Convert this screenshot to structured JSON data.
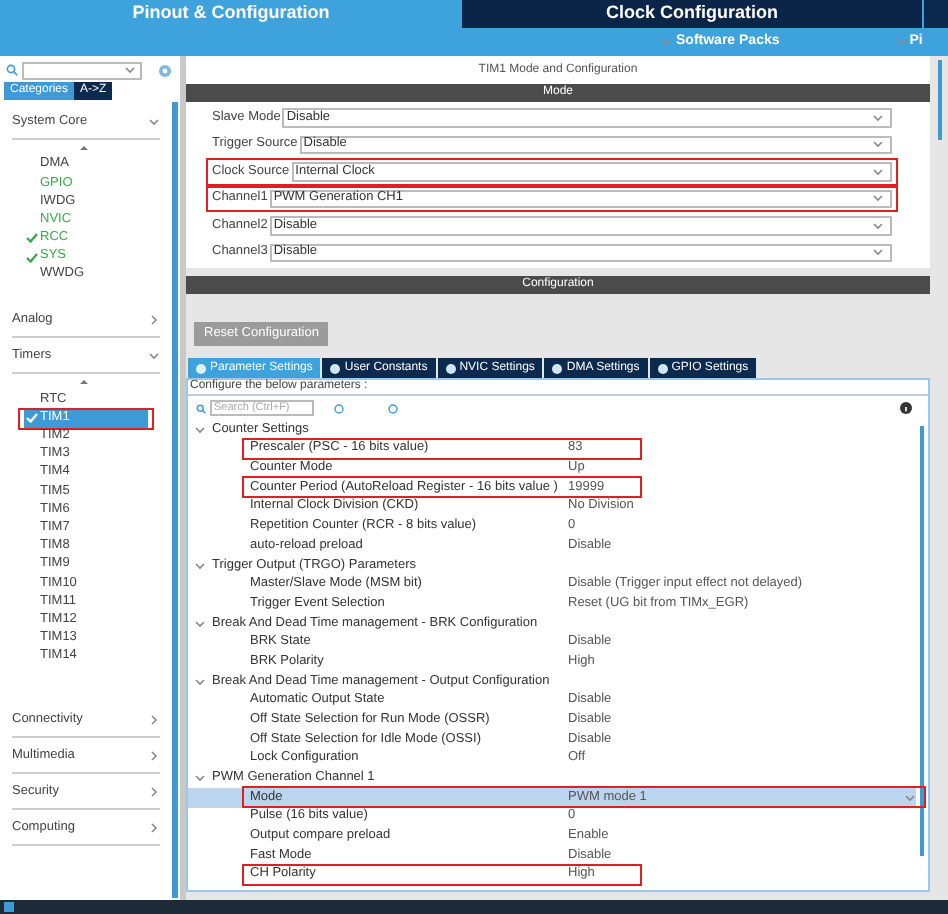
{
  "top_tabs": [
    {
      "label": "Pinout & Configuration",
      "selected": true
    },
    {
      "label": "Clock Configuration",
      "selected": false
    }
  ],
  "sub_bar": {
    "software_packs": "Software Packs",
    "cut_item": "Pi"
  },
  "sidebar": {
    "tabs": [
      {
        "label": "Categories",
        "selected": true
      },
      {
        "label": "A->Z",
        "selected": false
      }
    ],
    "categories": [
      {
        "label": "System Core",
        "expanded": true,
        "items": [
          {
            "label": "DMA",
            "kind": "plain",
            "selected": false,
            "highlighted": false
          },
          {
            "label": "GPIO",
            "kind": "partial",
            "selected": false,
            "highlighted": false
          },
          {
            "label": "IWDG",
            "kind": "plain",
            "selected": false,
            "highlighted": false
          },
          {
            "label": "NVIC",
            "kind": "partial",
            "selected": false,
            "highlighted": false
          },
          {
            "label": "RCC",
            "kind": "ok",
            "selected": false,
            "highlighted": false
          },
          {
            "label": "SYS",
            "kind": "ok",
            "selected": false,
            "highlighted": false
          },
          {
            "label": "WWDG",
            "kind": "plain",
            "selected": false,
            "highlighted": false
          }
        ]
      },
      {
        "label": "Analog",
        "expanded": false
      },
      {
        "label": "Timers",
        "expanded": true,
        "items": [
          {
            "label": "RTC",
            "kind": "plain",
            "selected": false,
            "highlighted": false
          },
          {
            "label": "TIM1",
            "kind": "ok",
            "selected": true,
            "highlighted": true
          },
          {
            "label": "TIM2",
            "kind": "plain",
            "selected": false,
            "highlighted": false
          },
          {
            "label": "TIM3",
            "kind": "plain",
            "selected": false,
            "highlighted": false
          },
          {
            "label": "TIM4",
            "kind": "plain",
            "selected": false,
            "highlighted": false
          },
          {
            "label": "TIM5",
            "kind": "plain",
            "selected": false,
            "highlighted": false
          },
          {
            "label": "TIM6",
            "kind": "plain",
            "selected": false,
            "highlighted": false
          },
          {
            "label": "TIM7",
            "kind": "plain",
            "selected": false,
            "highlighted": false
          },
          {
            "label": "TIM8",
            "kind": "plain",
            "selected": false,
            "highlighted": false
          },
          {
            "label": "TIM9",
            "kind": "plain",
            "selected": false,
            "highlighted": false
          },
          {
            "label": "TIM10",
            "kind": "plain",
            "selected": false,
            "highlighted": false
          },
          {
            "label": "TIM11",
            "kind": "plain",
            "selected": false,
            "highlighted": false
          },
          {
            "label": "TIM12",
            "kind": "plain",
            "selected": false,
            "highlighted": false
          },
          {
            "label": "TIM13",
            "kind": "plain",
            "selected": false,
            "highlighted": false
          },
          {
            "label": "TIM14",
            "kind": "plain",
            "selected": false,
            "highlighted": false
          }
        ]
      },
      {
        "label": "Connectivity",
        "expanded": false
      },
      {
        "label": "Multimedia",
        "expanded": false
      },
      {
        "label": "Security",
        "expanded": false
      },
      {
        "label": "Computing",
        "expanded": false
      }
    ]
  },
  "panel": {
    "title": "TIM1 Mode and Configuration",
    "mode_header": "Mode",
    "mode_rows": [
      {
        "label": "Slave Mode",
        "value": "Disable",
        "highlighted": false
      },
      {
        "label": "Trigger Source",
        "value": "Disable",
        "highlighted": false
      },
      {
        "label": "Clock Source",
        "value": "Internal Clock",
        "highlighted": true
      },
      {
        "label": "Channel1",
        "value": "PWM Generation CH1",
        "highlighted": true
      },
      {
        "label": "Channel2",
        "value": "Disable",
        "highlighted": false
      },
      {
        "label": "Channel3",
        "value": "Disable",
        "highlighted": false
      }
    ],
    "config_header": "Configuration",
    "reset_button": "Reset Configuration",
    "tabs": [
      {
        "label": "Parameter Settings",
        "selected": true
      },
      {
        "label": "User Constants",
        "selected": false
      },
      {
        "label": "NVIC Settings",
        "selected": false
      },
      {
        "label": "DMA Settings",
        "selected": false
      },
      {
        "label": "GPIO Settings",
        "selected": false
      }
    ],
    "hint": "Configure the below parameters :",
    "search": {
      "placeholder": "Search (Ctrl+F)"
    },
    "groups": [
      {
        "label": "Counter Settings",
        "expanded": true,
        "children": [
          {
            "label": "Prescaler (PSC - 16 bits value)",
            "value": "83",
            "selected": false,
            "highlighted": true
          },
          {
            "label": "Counter Mode",
            "value": "Up",
            "selected": false,
            "highlighted": false
          },
          {
            "label": "Counter Period (AutoReload Register - 16 bits value )",
            "value": "19999",
            "selected": false,
            "highlighted": true
          },
          {
            "label": "Internal Clock Division (CKD)",
            "value": "No Division",
            "selected": false,
            "highlighted": false
          },
          {
            "label": "Repetition Counter (RCR - 8 bits value)",
            "value": "0",
            "selected": false,
            "highlighted": false
          },
          {
            "label": "auto-reload preload",
            "value": "Disable",
            "selected": false,
            "highlighted": false
          }
        ]
      },
      {
        "label": "Trigger Output (TRGO) Parameters",
        "expanded": true,
        "children": [
          {
            "label": "Master/Slave Mode (MSM bit)",
            "value": "Disable (Trigger input effect not delayed)",
            "selected": false,
            "highlighted": false
          },
          {
            "label": "Trigger Event Selection",
            "value": "Reset (UG bit from TIMx_EGR)",
            "selected": false,
            "highlighted": false
          }
        ]
      },
      {
        "label": "Break And Dead Time management - BRK Configuration",
        "expanded": true,
        "children": [
          {
            "label": "BRK State",
            "value": "Disable",
            "selected": false,
            "highlighted": false
          },
          {
            "label": "BRK Polarity",
            "value": "High",
            "selected": false,
            "highlighted": false
          }
        ]
      },
      {
        "label": "Break And Dead Time management - Output Configuration",
        "expanded": true,
        "children": [
          {
            "label": "Automatic Output State",
            "value": "Disable",
            "selected": false,
            "highlighted": false
          },
          {
            "label": "Off State Selection for Run Mode (OSSR)",
            "value": "Disable",
            "selected": false,
            "highlighted": false
          },
          {
            "label": "Off State Selection for Idle Mode (OSSI)",
            "value": "Disable",
            "selected": false,
            "highlighted": false
          },
          {
            "label": "Lock Configuration",
            "value": "Off",
            "selected": false,
            "highlighted": false
          }
        ]
      },
      {
        "label": "PWM Generation Channel 1",
        "expanded": true,
        "children": [
          {
            "label": "Mode",
            "value": "PWM mode 1",
            "selected": true,
            "highlighted": true
          },
          {
            "label": "Pulse (16 bits value)",
            "value": "0",
            "selected": false,
            "highlighted": false
          },
          {
            "label": "Output compare preload",
            "value": "Enable",
            "selected": false,
            "highlighted": false
          },
          {
            "label": "Fast Mode",
            "value": "Disable",
            "selected": false,
            "highlighted": false
          },
          {
            "label": "CH Polarity",
            "value": "High",
            "selected": false,
            "highlighted": true
          }
        ]
      }
    ]
  }
}
